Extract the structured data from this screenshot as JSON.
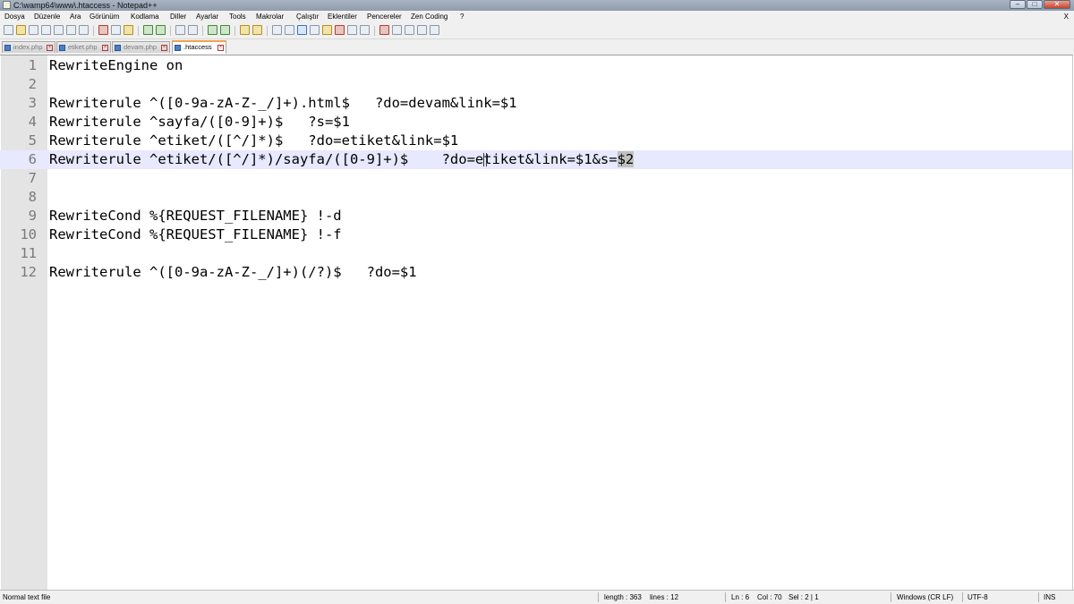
{
  "window": {
    "title": "C:\\wamp64\\www\\.htaccess - Notepad++",
    "minimize": "–",
    "maximize": "□",
    "close": "✕"
  },
  "menu": {
    "items": [
      "Dosya",
      "Düzenle",
      "Ara",
      "Görünüm",
      "Kodlama",
      "Diller",
      "Ayarlar",
      "Tools",
      "Makrolar",
      "Çalıştır",
      "Eklentiler",
      "Pencereler",
      "Zen Coding",
      "?"
    ],
    "close": "X"
  },
  "toolbar": {
    "icons": [
      "new-icon",
      "open-icon",
      "save-icon",
      "save-all-icon",
      "close-icon",
      "close-all-icon",
      "print-icon",
      "cut-icon",
      "copy-icon",
      "paste-icon",
      "undo-icon",
      "redo-icon",
      "find-icon",
      "replace-icon",
      "zoom-in-icon",
      "zoom-out-icon",
      "sync-vertical-icon",
      "sync-horizontal-icon",
      "word-wrap-icon",
      "show-all-chars-icon",
      "indent-guide-icon",
      "user-language-icon",
      "doc-map-icon",
      "function-list-icon",
      "folder-workspace-icon",
      "monitoring-icon",
      "record-macro-icon",
      "stop-record-icon",
      "play-macro-icon",
      "run-macro-multiple-icon",
      "save-macro-icon"
    ]
  },
  "tabs": [
    {
      "label": "index.php",
      "active": false
    },
    {
      "label": "etiket.php",
      "active": false
    },
    {
      "label": "devam.php",
      "active": false
    },
    {
      "label": ".htaccess",
      "active": true
    }
  ],
  "editor": {
    "lines": [
      {
        "num": "1",
        "text": "RewriteEngine on"
      },
      {
        "num": "2",
        "text": ""
      },
      {
        "num": "3",
        "text": "Rewriterule ^([0-9a-zA-Z-_/]+).html$   ?do=devam&link=$1"
      },
      {
        "num": "4",
        "text": "Rewriterule ^sayfa/([0-9]+)$   ?s=$1"
      },
      {
        "num": "5",
        "text": "Rewriterule ^etiket/([^/]*)$   ?do=etiket&link=$1"
      },
      {
        "num": "6",
        "text_before": "Rewriterule ^etiket/([^/]*)/sayfa/([0-9]+)$    ?do=etiket&link=$1&s=",
        "selected": "$2"
      },
      {
        "num": "7",
        "text": ""
      },
      {
        "num": "8",
        "text": ""
      },
      {
        "num": "9",
        "text": "RewriteCond %{REQUEST_FILENAME} !-d"
      },
      {
        "num": "10",
        "text": "RewriteCond %{REQUEST_FILENAME} !-f"
      },
      {
        "num": "11",
        "text": ""
      },
      {
        "num": "12",
        "text": "Rewriterule ^([0-9a-zA-Z-_/]+)(/?)$   ?do=$1"
      }
    ]
  },
  "status": {
    "filetype": "Normal text file",
    "length": "length : 363",
    "lines": "lines : 12",
    "ln": "Ln : 6",
    "col": "Col : 70",
    "sel": "Sel : 2 | 1",
    "eol": "Windows (CR LF)",
    "encoding": "UTF-8",
    "mode": "INS"
  },
  "colors": {
    "current_line": "#e8e8ff",
    "gutter": "#e4e4e4",
    "selection": "#c0c0c0",
    "active_tab_accent": "#f3a24b"
  }
}
